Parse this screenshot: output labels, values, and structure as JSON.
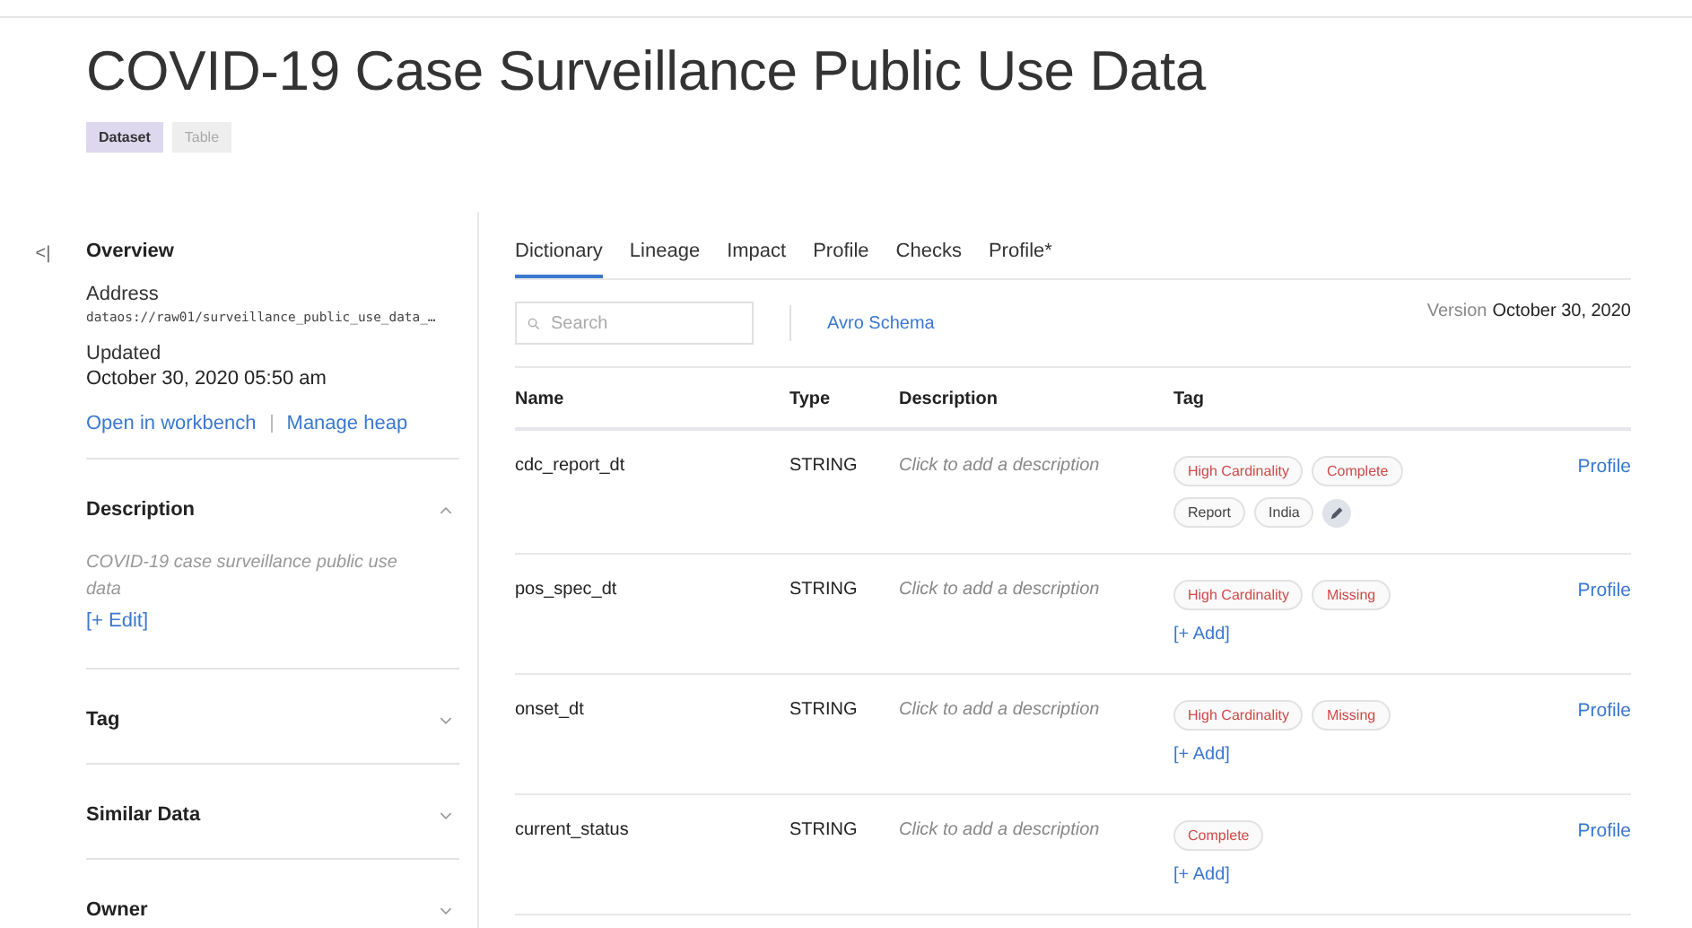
{
  "title": "COVID-19 Case Surveillance Public Use Data",
  "badges": [
    {
      "label": "Dataset",
      "selected": true
    },
    {
      "label": "Table",
      "selected": false
    }
  ],
  "collapse_icon": "<|",
  "sidebar": {
    "overview": {
      "heading": "Overview",
      "address_label": "Address",
      "address": "dataos://raw01/surveillance_public_use_data_…",
      "updated_label": "Updated",
      "updated": "October 30, 2020 05:50 am",
      "links": [
        "Open in workbench",
        "Manage heap"
      ]
    },
    "sections": [
      {
        "heading": "Description",
        "expanded": true,
        "text": "COVID-19 case surveillance public use data",
        "action": "[+ Edit]"
      },
      {
        "heading": "Tag",
        "expanded": false
      },
      {
        "heading": "Similar Data",
        "expanded": false
      },
      {
        "heading": "Owner",
        "expanded": false
      }
    ]
  },
  "tabs": [
    {
      "label": "Dictionary",
      "selected": true
    },
    {
      "label": "Lineage",
      "selected": false
    },
    {
      "label": "Impact",
      "selected": false
    },
    {
      "label": "Profile",
      "selected": false
    },
    {
      "label": "Checks",
      "selected": false
    },
    {
      "label": "Profile*",
      "selected": false
    }
  ],
  "search": {
    "placeholder": "Search"
  },
  "schema_link": "Avro Schema",
  "version": {
    "label": "Version",
    "value": "October 30, 2020"
  },
  "table": {
    "columns": [
      "Name",
      "Type",
      "Description",
      "Tag"
    ],
    "rows": [
      {
        "name": "cdc_report_dt",
        "type": "STRING",
        "description": "Click to add a description",
        "tags": [
          {
            "label": "High Cardinality",
            "kind": "status"
          },
          {
            "label": "Complete",
            "kind": "status"
          },
          {
            "label": "Report",
            "kind": "label"
          },
          {
            "label": "India",
            "kind": "label"
          }
        ],
        "editable": true,
        "action": "Profile"
      },
      {
        "name": "pos_spec_dt",
        "type": "STRING",
        "description": "Click to add a description",
        "tags": [
          {
            "label": "High Cardinality",
            "kind": "status"
          },
          {
            "label": "Missing",
            "kind": "status"
          }
        ],
        "add": "[+ Add]",
        "action": "Profile"
      },
      {
        "name": "onset_dt",
        "type": "STRING",
        "description": "Click to add a description",
        "tags": [
          {
            "label": "High Cardinality",
            "kind": "status"
          },
          {
            "label": "Missing",
            "kind": "status"
          }
        ],
        "add": "[+ Add]",
        "action": "Profile"
      },
      {
        "name": "current_status",
        "type": "STRING",
        "description": "Click to add a description",
        "tags": [
          {
            "label": "Complete",
            "kind": "status"
          }
        ],
        "add": "[+ Add]",
        "action": "Profile"
      }
    ]
  }
}
